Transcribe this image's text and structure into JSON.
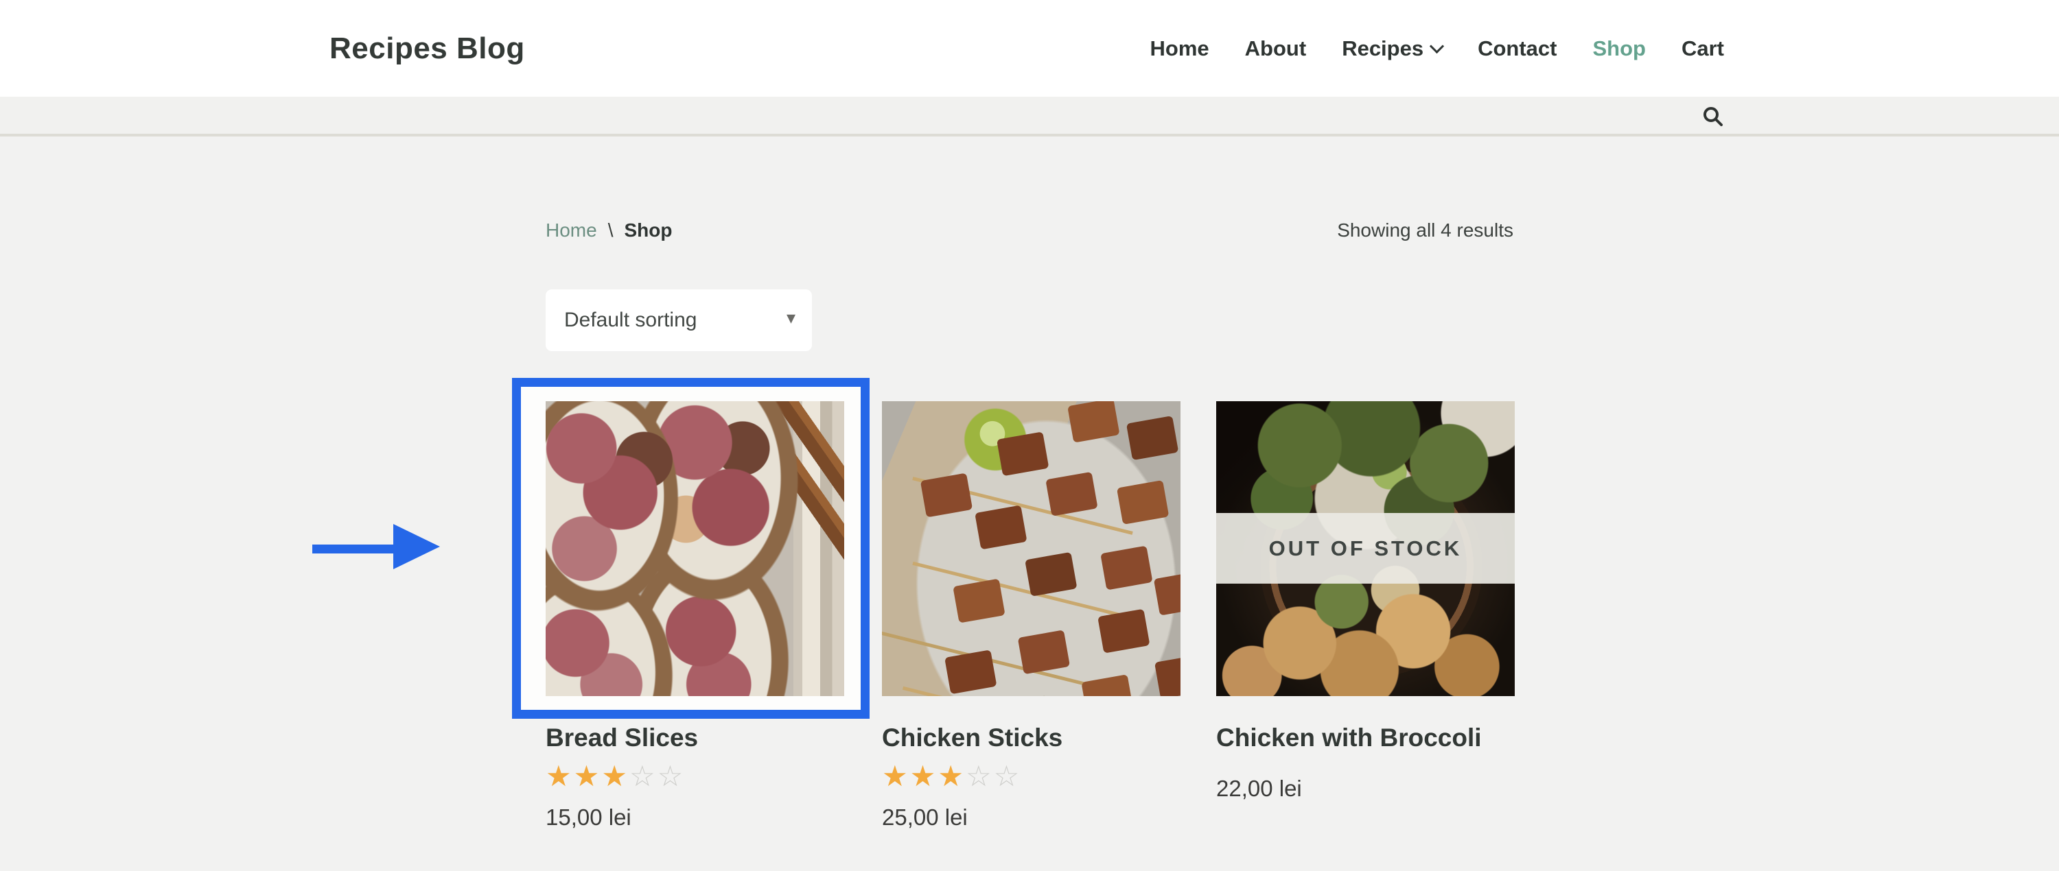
{
  "header": {
    "logo": "Recipes Blog",
    "nav_items": [
      {
        "label": "Home",
        "active": false,
        "has_dropdown": false
      },
      {
        "label": "About",
        "active": false,
        "has_dropdown": false
      },
      {
        "label": "Recipes",
        "active": false,
        "has_dropdown": true
      },
      {
        "label": "Contact",
        "active": false,
        "has_dropdown": false
      },
      {
        "label": "Shop",
        "active": true,
        "has_dropdown": false
      },
      {
        "label": "Cart",
        "active": false,
        "has_dropdown": false
      }
    ]
  },
  "toolbar": {
    "search_icon": "magnifying-glass"
  },
  "breadcrumb": {
    "items": [
      {
        "label": "Home",
        "link": true
      },
      {
        "label": "Shop",
        "link": false
      }
    ],
    "separator": "\\"
  },
  "shop": {
    "results_text": "Showing all 4 results",
    "sort": {
      "selected": "Default sorting",
      "arrow_glyph": "▾"
    },
    "products": [
      {
        "name": "Bread Slices",
        "price": "15,00 lei",
        "rating": 3,
        "max_rating": 5,
        "out_of_stock": false,
        "image": "fig-toast-photo",
        "highlighted": true
      },
      {
        "name": "Chicken Sticks",
        "price": "25,00 lei",
        "rating": 3,
        "max_rating": 5,
        "out_of_stock": false,
        "image": "tempeh-skewers-photo",
        "highlighted": false
      },
      {
        "name": "Chicken with Broccoli",
        "price": "22,00 lei",
        "rating": null,
        "max_rating": 5,
        "out_of_stock": true,
        "stock_label": "OUT OF STOCK",
        "image": "broccoli-bowl-photo",
        "highlighted": false
      }
    ]
  },
  "annotation": {
    "shape": "arrow-and-box-highlight",
    "color": "#2567e8"
  },
  "colors": {
    "accent_green": "#64a28e",
    "highlight_blue": "#2567e8",
    "star_filled": "#f3a93c",
    "star_empty": "#cfcfcc",
    "text_dark": "#343a37"
  }
}
